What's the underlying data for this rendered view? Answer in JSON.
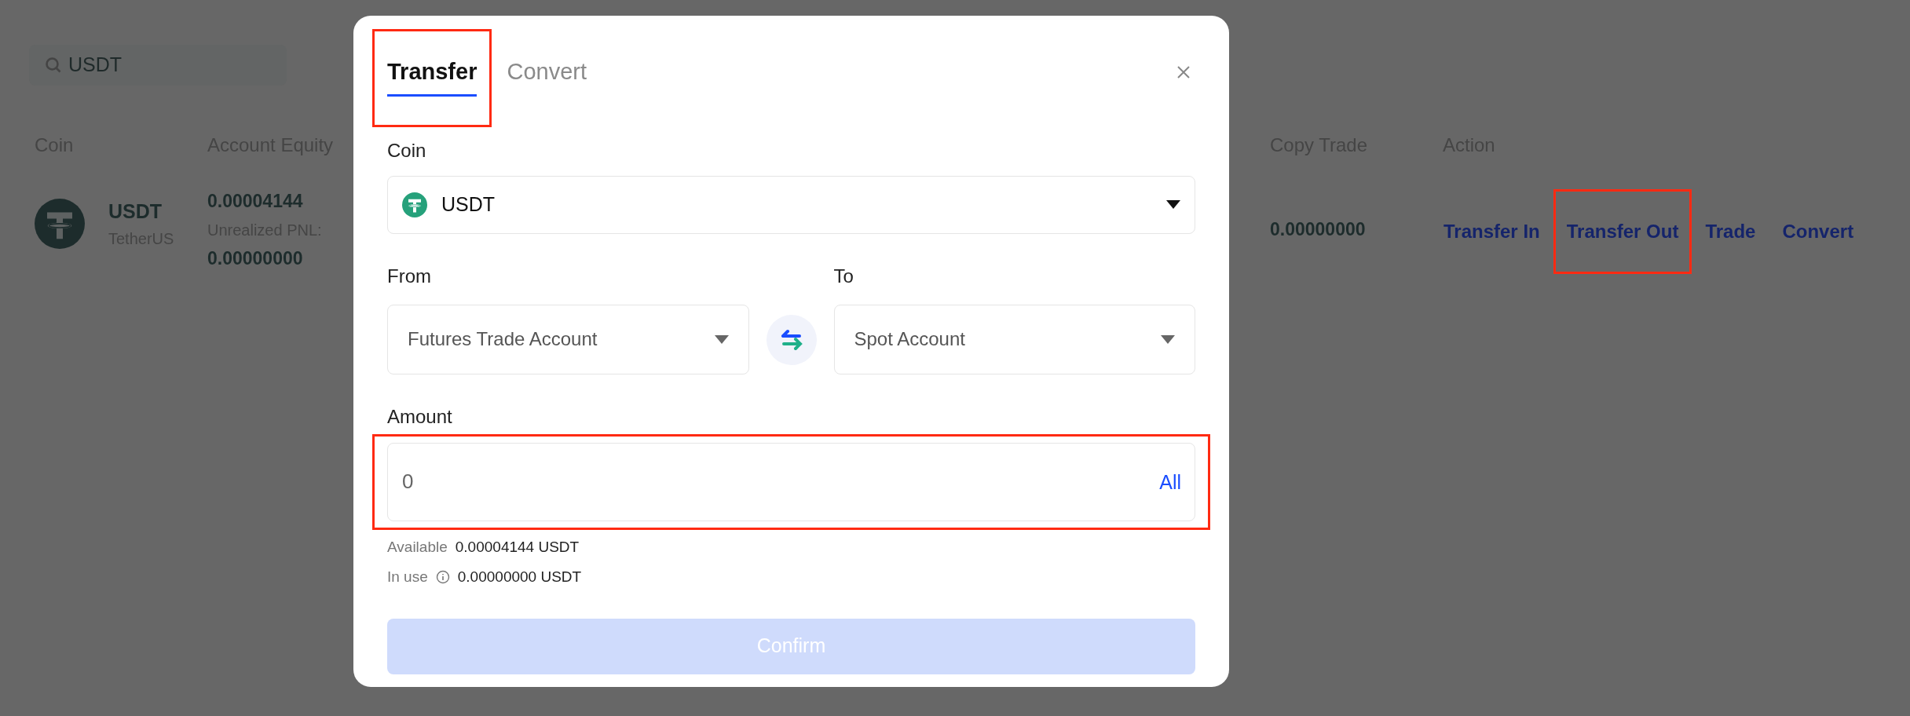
{
  "search": {
    "value": "USDT"
  },
  "table": {
    "columns": [
      "Coin",
      "Account Equity",
      "Copy Trade",
      "Action"
    ],
    "rows": [
      {
        "coin": "USDT",
        "coin_name": "TetherUS",
        "equity": "0.00004144",
        "pnl_label": "Unrealized PNL:",
        "pnl": "0.00000000",
        "copy_trade": "0.00000000",
        "actions": [
          {
            "label": "Transfer In",
            "highlighted": false
          },
          {
            "label": "Transfer Out",
            "highlighted": true
          },
          {
            "label": "Trade",
            "highlighted": false
          },
          {
            "label": "Convert",
            "highlighted": false
          }
        ]
      }
    ]
  },
  "dialog": {
    "tabs": [
      {
        "label": "Transfer",
        "selected": true,
        "highlighted": true
      },
      {
        "label": "Convert",
        "selected": false,
        "highlighted": false
      }
    ],
    "coin": {
      "label": "Coin",
      "value": "USDT"
    },
    "from": {
      "label": "From",
      "value": "Futures Trade Account"
    },
    "to": {
      "label": "To",
      "value": "Spot Account"
    },
    "amount": {
      "label": "Amount",
      "placeholder": "0",
      "action": "All",
      "highlighted": true
    },
    "available": {
      "label": "Available",
      "value": "0.00004144 USDT"
    },
    "in_use": {
      "label": "In use",
      "value": "0.00000000 USDT"
    },
    "confirm": {
      "label": "Confirm",
      "disabled": true
    }
  }
}
